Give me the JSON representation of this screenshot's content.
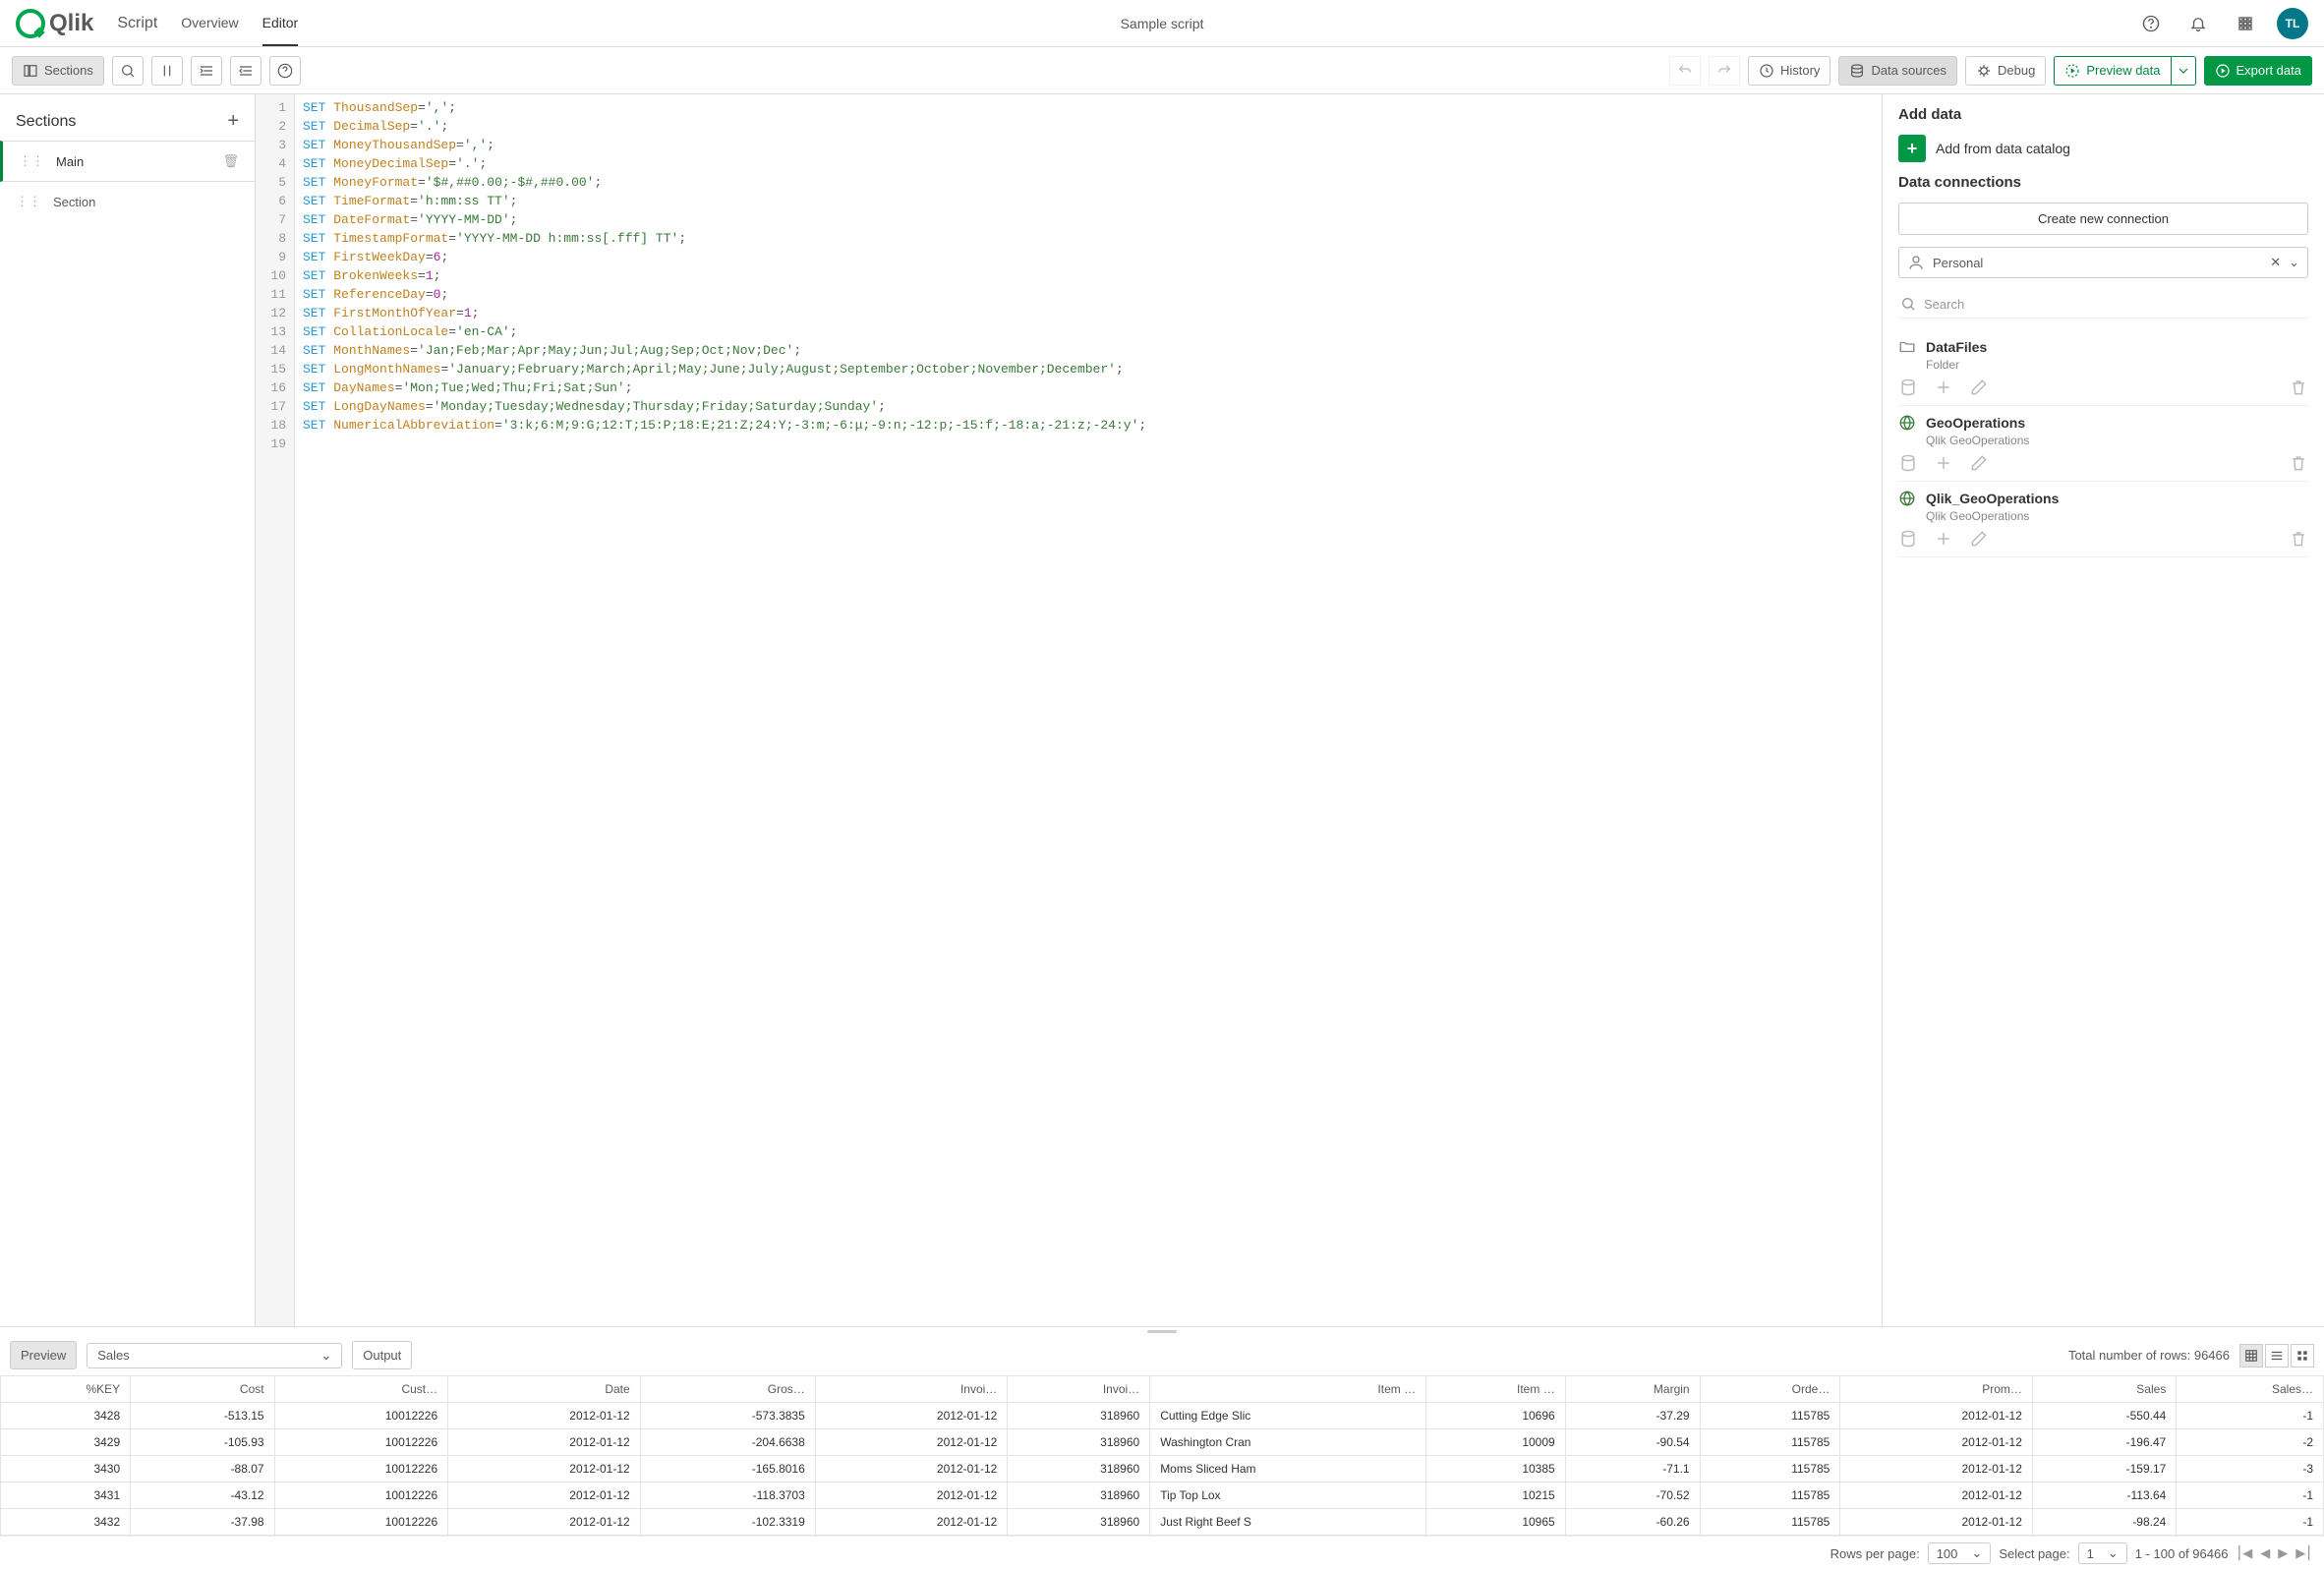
{
  "header": {
    "app": "Qlik",
    "view": "Script",
    "tabs": [
      "Overview",
      "Editor"
    ],
    "activeTab": 1,
    "title": "Sample script",
    "avatar": "TL"
  },
  "toolbar": {
    "sections": "Sections",
    "history": "History",
    "dataSources": "Data sources",
    "debug": "Debug",
    "previewData": "Preview data",
    "exportData": "Export data"
  },
  "sections": {
    "title": "Sections",
    "items": [
      {
        "name": "Main",
        "active": true
      },
      {
        "name": "Section",
        "active": false
      }
    ]
  },
  "code": [
    {
      "var": "ThousandSep",
      "value": "','"
    },
    {
      "var": "DecimalSep",
      "value": "'.'"
    },
    {
      "var": "MoneyThousandSep",
      "value": "','"
    },
    {
      "var": "MoneyDecimalSep",
      "value": "'.'"
    },
    {
      "var": "MoneyFormat",
      "value": "'$#,##0.00;-$#,##0.00'"
    },
    {
      "var": "TimeFormat",
      "value": "'h:mm:ss TT'"
    },
    {
      "var": "DateFormat",
      "value": "'YYYY-MM-DD'"
    },
    {
      "var": "TimestampFormat",
      "value": "'YYYY-MM-DD h:mm:ss[.fff] TT'"
    },
    {
      "var": "FirstWeekDay",
      "value": "6",
      "numeric": true
    },
    {
      "var": "BrokenWeeks",
      "value": "1",
      "numeric": true
    },
    {
      "var": "ReferenceDay",
      "value": "0",
      "numeric": true
    },
    {
      "var": "FirstMonthOfYear",
      "value": "1",
      "numeric": true
    },
    {
      "var": "CollationLocale",
      "value": "'en-CA'"
    },
    {
      "var": "MonthNames",
      "value": "'Jan;Feb;Mar;Apr;May;Jun;Jul;Aug;Sep;Oct;Nov;Dec'"
    },
    {
      "var": "LongMonthNames",
      "value": "'January;February;March;April;May;June;July;August;September;October;November;December'"
    },
    {
      "var": "DayNames",
      "value": "'Mon;Tue;Wed;Thu;Fri;Sat;Sun'"
    },
    {
      "var": "LongDayNames",
      "value": "'Monday;Tuesday;Wednesday;Thursday;Friday;Saturday;Sunday'"
    },
    {
      "var": "NumericalAbbreviation",
      "value": "'3:k;6:M;9:G;12:T;15:P;18:E;21:Z;24:Y;-3:m;-6:μ;-9:n;-12:p;-15:f;-18:a;-21:z;-24:y'"
    }
  ],
  "dataPanel": {
    "addData": "Add data",
    "addFromCatalog": "Add from data catalog",
    "dataConnections": "Data connections",
    "createNew": "Create new connection",
    "space": "Personal",
    "searchPlaceholder": "Search",
    "connections": [
      {
        "name": "DataFiles",
        "sub": "Folder",
        "icon": "folder"
      },
      {
        "name": "GeoOperations",
        "sub": "Qlik GeoOperations",
        "icon": "globe"
      },
      {
        "name": "Qlik_GeoOperations",
        "sub": "Qlik GeoOperations",
        "icon": "globe"
      }
    ]
  },
  "preview": {
    "previewBtn": "Preview",
    "table": "Sales",
    "outputBtn": "Output",
    "totalRowsLabel": "Total number of rows:",
    "totalRows": "96466",
    "columns": [
      "%KEY",
      "Cost",
      "Cust…",
      "Date",
      "Gros…",
      "Invoi…",
      "Invoi…",
      "Item …",
      "Item …",
      "Margin",
      "Orde…",
      "Prom…",
      "Sales",
      "Sales…"
    ],
    "rows": [
      [
        "3428",
        "-513.15",
        "10012226",
        "2012-01-12",
        "-573.3835",
        "2012-01-12",
        "318960",
        "Cutting Edge Slic",
        "10696",
        "-37.29",
        "115785",
        "2012-01-12",
        "-550.44",
        "-1"
      ],
      [
        "3429",
        "-105.93",
        "10012226",
        "2012-01-12",
        "-204.6638",
        "2012-01-12",
        "318960",
        "Washington Cran",
        "10009",
        "-90.54",
        "115785",
        "2012-01-12",
        "-196.47",
        "-2"
      ],
      [
        "3430",
        "-88.07",
        "10012226",
        "2012-01-12",
        "-165.8016",
        "2012-01-12",
        "318960",
        "Moms Sliced Ham",
        "10385",
        "-71.1",
        "115785",
        "2012-01-12",
        "-159.17",
        "-3"
      ],
      [
        "3431",
        "-43.12",
        "10012226",
        "2012-01-12",
        "-118.3703",
        "2012-01-12",
        "318960",
        "Tip Top Lox",
        "10215",
        "-70.52",
        "115785",
        "2012-01-12",
        "-113.64",
        "-1"
      ],
      [
        "3432",
        "-37.98",
        "10012226",
        "2012-01-12",
        "-102.3319",
        "2012-01-12",
        "318960",
        "Just Right Beef S",
        "10965",
        "-60.26",
        "115785",
        "2012-01-12",
        "-98.24",
        "-1"
      ]
    ],
    "rowsPerPageLabel": "Rows per page:",
    "rowsPerPage": "100",
    "selectPageLabel": "Select page:",
    "selectPage": "1",
    "range": "1 - 100 of 96466"
  }
}
